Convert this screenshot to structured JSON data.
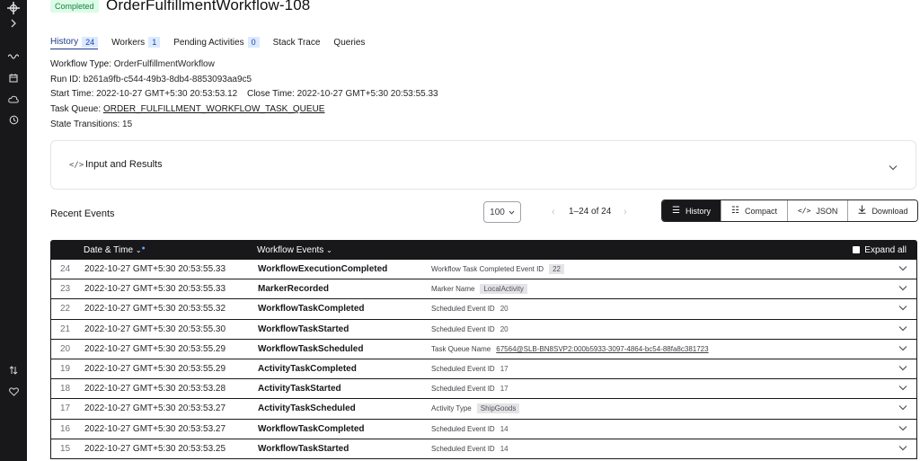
{
  "sidebar": {
    "icons": [
      "logo-icon",
      "chevron-right-icon",
      "wave-icon",
      "calendar-icon",
      "cloud-icon",
      "history-icon",
      "sort-icon",
      "heart-icon"
    ]
  },
  "header": {
    "status": "Completed",
    "title": "OrderFulfillmentWorkflow-108"
  },
  "tabs": [
    {
      "label": "History",
      "count": "24"
    },
    {
      "label": "Workers",
      "count": "1"
    },
    {
      "label": "Pending Activities",
      "count": "0"
    },
    {
      "label": "Stack Trace",
      "count": null
    },
    {
      "label": "Queries",
      "count": null
    }
  ],
  "meta": {
    "workflow_type_label": "Workflow Type:",
    "workflow_type": "OrderFulfillmentWorkflow",
    "run_id_label": "Run ID:",
    "run_id": "b261a9fb-c544-49b3-8db4-8853093aa9c5",
    "start_time_label": "Start Time:",
    "start_time": "2022-10-27 GMT+5:30 20:53:53.12",
    "close_time_label": "Close Time:",
    "close_time": "2022-10-27 GMT+5:30 20:53:55.33",
    "task_queue_label": "Task Queue:",
    "task_queue": "ORDER_FULFILLMENT_WORKFLOW_TASK_QUEUE",
    "state_transitions_label": "State Transitions:",
    "state_transitions": "15"
  },
  "input_results": {
    "title": "Input and Results"
  },
  "recent_events": {
    "title": "Recent Events",
    "page_size": "100",
    "pager": "1–24 of 24",
    "view_buttons": [
      "History",
      "Compact",
      "JSON",
      "Download"
    ],
    "columns": {
      "date": "Date & Time",
      "events": "Workflow Events",
      "expand_all": "Expand all"
    },
    "rows": [
      {
        "num": "24",
        "date": "2022-10-27 GMT+5:30 20:53:55.33",
        "event": "WorkflowExecutionCompleted",
        "detail_label": "Workflow Task Completed Event ID",
        "detail_value": "22",
        "detail_style": "pill"
      },
      {
        "num": "23",
        "date": "2022-10-27 GMT+5:30 20:53:55.33",
        "event": "MarkerRecorded",
        "detail_label": "Marker Name",
        "detail_value": "LocalActivity",
        "detail_style": "pill"
      },
      {
        "num": "22",
        "date": "2022-10-27 GMT+5:30 20:53:55.32",
        "event": "WorkflowTaskCompleted",
        "detail_label": "Scheduled Event ID",
        "detail_value": "20",
        "detail_style": "plain"
      },
      {
        "num": "21",
        "date": "2022-10-27 GMT+5:30 20:53:55.30",
        "event": "WorkflowTaskStarted",
        "detail_label": "Scheduled Event ID",
        "detail_value": "20",
        "detail_style": "plain"
      },
      {
        "num": "20",
        "date": "2022-10-27 GMT+5:30 20:53:55.29",
        "event": "WorkflowTaskScheduled",
        "detail_label": "Task Queue Name",
        "detail_value": "67564@SLB-BN8SVP2:000b5933-3097-4864-bc54-88fa8c381723",
        "detail_style": "link"
      },
      {
        "num": "19",
        "date": "2022-10-27 GMT+5:30 20:53:55.29",
        "event": "ActivityTaskCompleted",
        "detail_label": "Scheduled Event ID",
        "detail_value": "17",
        "detail_style": "plain"
      },
      {
        "num": "18",
        "date": "2022-10-27 GMT+5:30 20:53:53.28",
        "event": "ActivityTaskStarted",
        "detail_label": "Scheduled Event ID",
        "detail_value": "17",
        "detail_style": "plain"
      },
      {
        "num": "17",
        "date": "2022-10-27 GMT+5:30 20:53:53.27",
        "event": "ActivityTaskScheduled",
        "detail_label": "Activity Type",
        "detail_value": "ShipGoods",
        "detail_style": "pill"
      },
      {
        "num": "16",
        "date": "2022-10-27 GMT+5:30 20:53:53.27",
        "event": "WorkflowTaskCompleted",
        "detail_label": "Scheduled Event ID",
        "detail_value": "14",
        "detail_style": "plain"
      },
      {
        "num": "15",
        "date": "2022-10-27 GMT+5:30 20:53:53.25",
        "event": "WorkflowTaskStarted",
        "detail_label": "Scheduled Event ID",
        "detail_value": "14",
        "detail_style": "plain"
      }
    ]
  }
}
